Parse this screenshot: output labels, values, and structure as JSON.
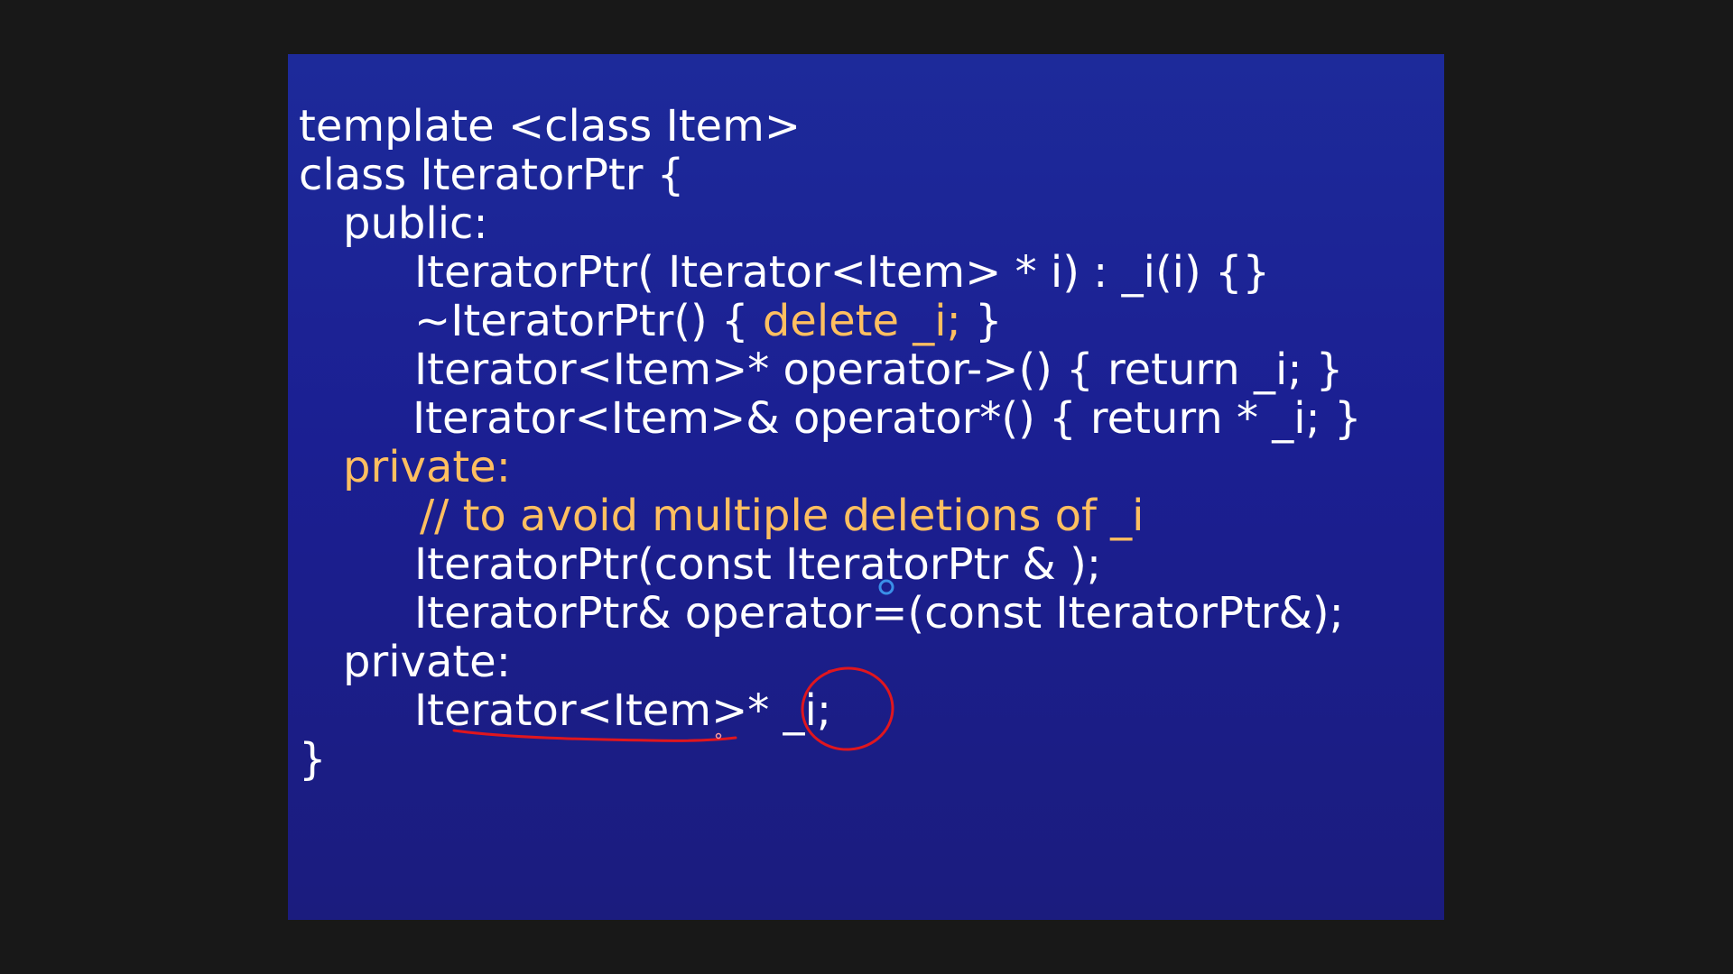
{
  "slide": {
    "background_color": "#1b1f92",
    "text_color": "#ffffff",
    "accent_color": "#ffbf60",
    "lines": [
      {
        "text": "template <class Item>"
      },
      {
        "text": "class IteratorPtr {"
      },
      {
        "text": "public:"
      },
      {
        "text": "IteratorPtr( Iterator<Item> * i) : _i(i) {}"
      },
      {
        "pre": "~IteratorPtr() { ",
        "accent": "delete _i;",
        "post": " }"
      },
      {
        "text": "Iterator<Item>* operator->() { return _i; }"
      },
      {
        "text": "Iterator<Item>& operator*() { return * _i; }"
      },
      {
        "text": "private:"
      },
      {
        "text": "// to avoid multiple deletions of _i"
      },
      {
        "text": "IteratorPtr(const IteratorPtr & );"
      },
      {
        "text": "IteratorPtr& operator=(const IteratorPtr&);"
      },
      {
        "text": "private:"
      },
      {
        "pre": "Iterator<Item>* ",
        "circled": "_i;"
      },
      {
        "text": "}"
      }
    ]
  },
  "annotations": {
    "pen_color": "#e0161e",
    "cursor_color": "#3a8fe8",
    "items": [
      "underline",
      "circle",
      "cursor"
    ]
  }
}
